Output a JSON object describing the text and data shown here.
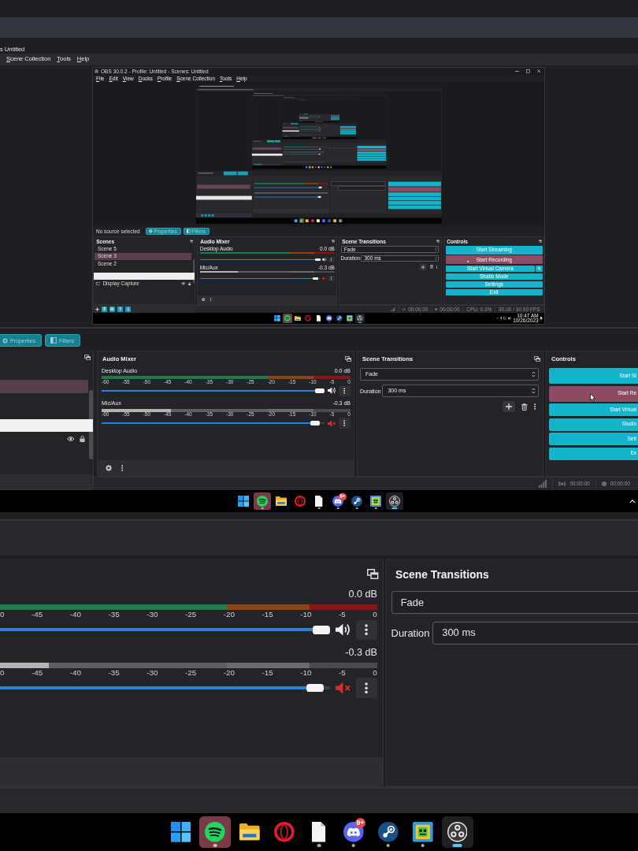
{
  "upper_window": {
    "title": "s Untitled",
    "menu": [
      {
        "label": "Scene Collection"
      },
      {
        "label": "Tools"
      },
      {
        "label": "Help"
      }
    ]
  },
  "captured_window": {
    "title": "OBS 30.0.2 - Profile: Untitled - Scenes: Untitled",
    "menu": [
      {
        "label": "File"
      },
      {
        "label": "Edit"
      },
      {
        "label": "View"
      },
      {
        "label": "Docks"
      },
      {
        "label": "Profile"
      },
      {
        "label": "Scene Collection"
      },
      {
        "label": "Tools"
      },
      {
        "label": "Help"
      }
    ],
    "source_toolbar": {
      "status": "No source selected",
      "buttons": [
        {
          "kind": "properties",
          "label": "Properties",
          "disabled": true
        },
        {
          "kind": "filters",
          "label": "Filters",
          "disabled": true
        }
      ]
    },
    "scenes": {
      "title": "Scenes",
      "items": [
        {
          "name": "Scene 5",
          "selected": false
        },
        {
          "name": "Scene 3",
          "selected": true
        },
        {
          "name": "Scene 2",
          "selected": false
        }
      ]
    },
    "sources": {
      "items": [
        {
          "name": "Display Capture"
        }
      ]
    },
    "audio_mixer": {
      "title": "Audio Mixer",
      "channels": [
        {
          "name": "Desktop Audio",
          "reading": "0.0 dB",
          "muted": false,
          "level": 1
        },
        {
          "name": "Mic/Aux",
          "reading": "-0.3 dB",
          "muted": true,
          "level": 0.98,
          "meter": {
            "level": 0.28
          }
        }
      ]
    },
    "transitions": {
      "title": "Scene Transitions",
      "transition": "Fade",
      "duration_label": "Duration",
      "duration": "300 ms"
    },
    "controls": {
      "title": "Controls",
      "buttons": [
        {
          "label": "Start Streaming",
          "hovered": false,
          "settings": false
        },
        {
          "label": "Start Recording",
          "hovered": true,
          "settings": false
        },
        {
          "label": "Start Virtual Camera",
          "hovered": false,
          "settings": true
        },
        {
          "label": "Studio Mode",
          "hovered": false,
          "settings": false
        },
        {
          "label": "Settings",
          "hovered": false,
          "settings": false
        },
        {
          "label": "Exit",
          "hovered": false,
          "settings": false
        }
      ]
    },
    "status_bar": [
      {
        "kind": "stream",
        "text": "00:00:00"
      },
      {
        "kind": "record",
        "text": "00:00:00"
      },
      {
        "kind": "cpu",
        "text": "CPU: 0.3%"
      },
      {
        "kind": "fps",
        "text": "30.00 / 30.00 FPS"
      }
    ],
    "taskbar": {
      "apps": [
        {
          "kind": "start",
          "running": false,
          "active": false,
          "attention": false
        },
        {
          "kind": "music",
          "running": true,
          "active": false,
          "attention": true
        },
        {
          "kind": "files",
          "running": false,
          "active": false,
          "attention": false
        },
        {
          "kind": "browser",
          "running": false,
          "active": false,
          "attention": false
        },
        {
          "kind": "document",
          "running": true,
          "active": false,
          "attention": false
        },
        {
          "kind": "chat",
          "running": true,
          "active": false,
          "attention": false
        },
        {
          "kind": "store",
          "running": true,
          "active": false,
          "attention": false
        },
        {
          "kind": "game",
          "running": true,
          "active": false,
          "attention": false
        },
        {
          "kind": "recorder",
          "running": true,
          "active": true,
          "attention": false
        }
      ],
      "clock": "10:47 AM",
      "date": "10/26/2023"
    }
  },
  "middle_window": {
    "source_toolbar": {
      "buttons": [
        {
          "kind": "properties",
          "label": "Properties",
          "disabled": true
        },
        {
          "kind": "filters",
          "label": "Filters",
          "disabled": true
        }
      ]
    },
    "scenes": {
      "rows": [
        {
          "selected": true
        }
      ]
    },
    "audio_mixer": {
      "title": "Audio Mixer",
      "channels": [
        {
          "name": "Desktop Audio",
          "reading": "0.0 dB",
          "muted": false,
          "level": 1,
          "scale": [
            "-60",
            "-55",
            "-50",
            "-45",
            "-40",
            "-35",
            "-30",
            "-25",
            "-20",
            "-15",
            "-10",
            "-5",
            "0"
          ]
        },
        {
          "name": "Mic/Aux",
          "reading": "-0.3 dB",
          "muted": true,
          "level": 0.98,
          "meter": {
            "level": 0.28
          },
          "scale": [
            "-60",
            "-55",
            "-50",
            "-45",
            "-40",
            "-35",
            "-30",
            "-25",
            "-20",
            "-15",
            "-10",
            "-5",
            "0"
          ]
        }
      ]
    },
    "transitions": {
      "title": "Scene Transitions",
      "transition": "Fade",
      "duration_label": "Duration",
      "duration": "300 ms"
    },
    "controls": {
      "title": "Controls",
      "buttons": [
        {
          "label": "Start St",
          "hovered": false
        },
        {
          "label": "Start Re",
          "hovered": true
        },
        {
          "label": "Start Virtual",
          "hovered": false
        },
        {
          "label": "Studio",
          "hovered": false
        },
        {
          "label": "Sett",
          "hovered": false
        },
        {
          "label": "Ex",
          "hovered": false
        }
      ]
    },
    "status_bar": [
      {
        "kind": "stream",
        "text": "00:00:00"
      },
      {
        "kind": "record",
        "text": "00:00:00"
      }
    ],
    "taskbar": {
      "apps": [
        {
          "kind": "start",
          "running": false,
          "active": false,
          "attention": false
        },
        {
          "kind": "music",
          "running": true,
          "active": false,
          "attention": true
        },
        {
          "kind": "files",
          "running": false,
          "active": false,
          "attention": false
        },
        {
          "kind": "browser",
          "running": false,
          "active": false,
          "attention": false
        },
        {
          "kind": "document",
          "running": true,
          "active": false,
          "attention": false
        },
        {
          "kind": "chat",
          "running": true,
          "active": false,
          "attention": false,
          "badge": "9+"
        },
        {
          "kind": "store",
          "running": true,
          "active": false,
          "attention": false
        },
        {
          "kind": "game",
          "running": true,
          "active": false,
          "attention": false
        },
        {
          "kind": "recorder",
          "running": true,
          "active": true,
          "attention": false
        }
      ]
    }
  },
  "lower_window": {
    "audio_mixer": {
      "channels": [
        {
          "reading": "0.0 dB",
          "muted": false,
          "level": 1,
          "scale": [
            "0",
            "-45",
            "-40",
            "-35",
            "-30",
            "-25",
            "-20",
            "-15",
            "-10",
            "-5",
            "0"
          ]
        },
        {
          "reading": "-0.3 dB",
          "muted": true,
          "level": 0.98,
          "meter": {
            "level": 0.13
          },
          "scale": [
            "0",
            "-45",
            "-40",
            "-35",
            "-30",
            "-25",
            "-20",
            "-15",
            "-10",
            "-5",
            "0"
          ]
        }
      ]
    },
    "transitions": {
      "title": "Scene Transitions",
      "transition": "Fade",
      "duration_label": "Duration",
      "duration": "300 ms"
    },
    "taskbar": {
      "apps": [
        {
          "kind": "start",
          "running": false,
          "active": false,
          "attention": false
        },
        {
          "kind": "music",
          "running": true,
          "active": false,
          "attention": true
        },
        {
          "kind": "files",
          "running": false,
          "active": false,
          "attention": false
        },
        {
          "kind": "browser",
          "running": false,
          "active": false,
          "attention": false
        },
        {
          "kind": "document",
          "running": true,
          "active": false,
          "attention": false
        },
        {
          "kind": "chat",
          "running": true,
          "active": false,
          "attention": false,
          "badge": "9+"
        },
        {
          "kind": "store",
          "running": true,
          "active": false,
          "attention": false
        },
        {
          "kind": "game",
          "running": true,
          "active": false,
          "attention": false
        },
        {
          "kind": "recorder",
          "running": true,
          "active": true,
          "attention": false
        }
      ]
    }
  }
}
